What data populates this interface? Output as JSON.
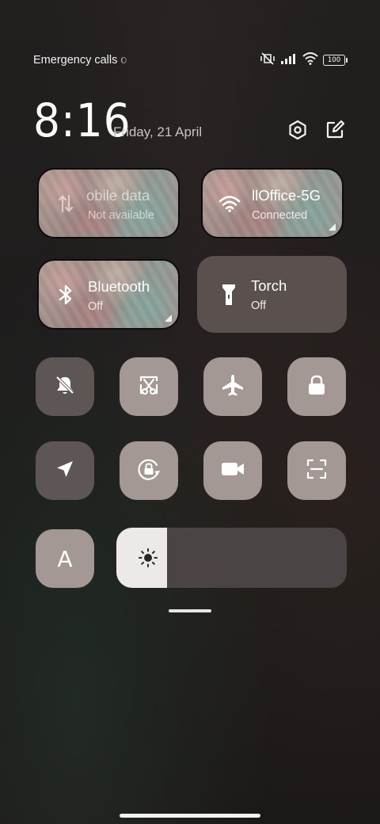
{
  "status_bar": {
    "carrier_text": "Emergency calls o",
    "battery_level": "100",
    "icons": [
      "mute-vibrate-icon",
      "signal-icon",
      "wifi-icon",
      "battery-icon"
    ]
  },
  "header": {
    "time": "8:16",
    "date": "Friday, 21 April",
    "icons": [
      "settings-icon",
      "edit-icon"
    ]
  },
  "tiles": {
    "mobile_data": {
      "title": "obile data",
      "subtitle": "Not available",
      "icon": "mobile-data-icon",
      "active": false
    },
    "wifi": {
      "title": "llOffice-5G",
      "subtitle": "Connected",
      "icon": "wifi-icon",
      "active": true
    },
    "bluetooth": {
      "title": "Bluetooth",
      "subtitle": "Off",
      "icon": "bluetooth-icon",
      "active": false
    },
    "torch": {
      "title": "Torch",
      "subtitle": "Off",
      "icon": "flashlight-icon",
      "active": false
    }
  },
  "toggles": [
    {
      "name": "silent-mode-toggle",
      "icon": "bell-off-icon",
      "active": false
    },
    {
      "name": "screenshot-toggle",
      "icon": "scissors-icon",
      "active": true
    },
    {
      "name": "airplane-mode-toggle",
      "icon": "airplane-icon",
      "active": true
    },
    {
      "name": "lock-screen-toggle",
      "icon": "lock-icon",
      "active": true
    },
    {
      "name": "location-toggle",
      "icon": "location-arrow-icon",
      "active": false
    },
    {
      "name": "rotation-lock-toggle",
      "icon": "rotation-lock-icon",
      "active": true
    },
    {
      "name": "screen-recorder-toggle",
      "icon": "video-camera-icon",
      "active": true
    },
    {
      "name": "scanner-toggle",
      "icon": "scan-icon",
      "active": true
    },
    {
      "name": "auto-brightness-toggle",
      "icon": "letter-a-icon",
      "label": "A",
      "active": true
    }
  ],
  "brightness": {
    "level": 0.22,
    "icon": "sun-icon"
  },
  "colors": {
    "tile_active": "#a39894",
    "tile_inactive": "#5d5654",
    "brightness_fill": "#ece9e8",
    "brightness_track": "#4a4444"
  }
}
